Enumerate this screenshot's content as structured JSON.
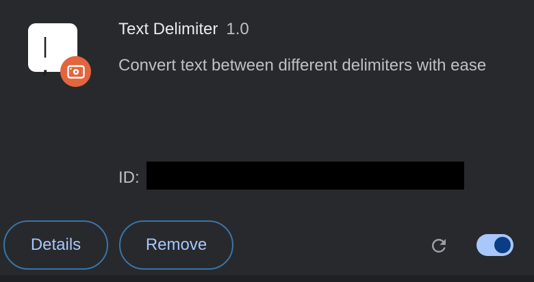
{
  "extension": {
    "name": "Text Delimiter",
    "version": "1.0",
    "description": "Convert text between different delimiters with ease",
    "icon_glyph": "| ,",
    "icon_name": "text-delimiter-icon",
    "badge_icon": "unpacked-extension-icon",
    "id_label": "ID:",
    "id_value_redacted": true
  },
  "actions": {
    "details_label": "Details",
    "remove_label": "Remove",
    "reload_icon": "reload-icon",
    "enabled": true
  },
  "colors": {
    "background": "#28292d",
    "button_text": "#a8c7fa",
    "button_border": "#3a75a8",
    "badge": "#e2653d",
    "toggle_track": "#a8c7fa",
    "toggle_knob": "#0b3d86"
  }
}
